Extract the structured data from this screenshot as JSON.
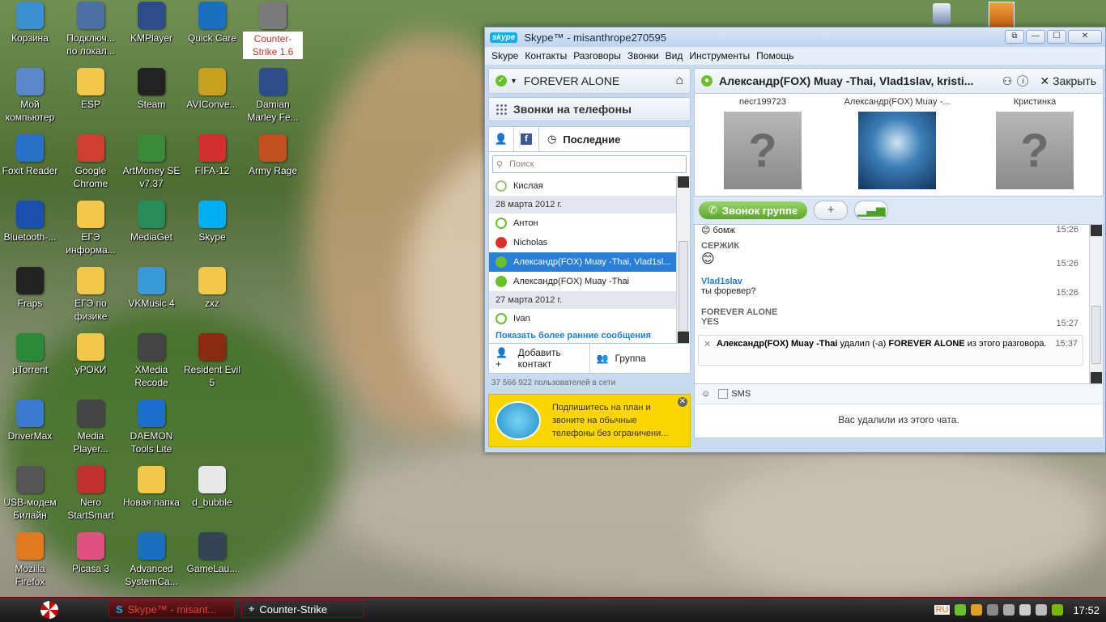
{
  "desktop": {
    "icons": [
      {
        "label": "Корзина",
        "icon": "recycle-bin-icon",
        "color": "#3a8fd0"
      },
      {
        "label": "Подключ... по локал...",
        "icon": "network-connection-icon",
        "color": "#4a6fa0"
      },
      {
        "label": "KMPlayer",
        "icon": "kmplayer-icon",
        "color": "#2c4d8a"
      },
      {
        "label": "Quick Care",
        "icon": "quick-care-icon",
        "color": "#1a6fc0"
      },
      {
        "label": "Counter-Strike 1.6",
        "icon": "counter-strike-icon",
        "color": "#7a7a7a"
      },
      {
        "label": "Мой компьютер",
        "icon": "my-computer-icon",
        "color": "#5a88c8"
      },
      {
        "label": "ESP",
        "icon": "folder-icon",
        "color": "#f2c84b"
      },
      {
        "label": "Steam",
        "icon": "steam-icon",
        "color": "#222222"
      },
      {
        "label": "AVIConve...",
        "icon": "avi-converter-icon",
        "color": "#c8a020"
      },
      {
        "label": "Damian Marley Fe...",
        "icon": "media-file-icon",
        "color": "#2c4d8a"
      },
      {
        "label": "Foxit Reader",
        "icon": "foxit-reader-icon",
        "color": "#2a6fc8"
      },
      {
        "label": "Google Chrome",
        "icon": "chrome-icon",
        "color": "#d04030"
      },
      {
        "label": "ArtMoney SE v7.37",
        "icon": "artmoney-icon",
        "color": "#3a8a3a"
      },
      {
        "label": "FIFA-12",
        "icon": "fifa-icon",
        "color": "#d03030"
      },
      {
        "label": "Army Rage",
        "icon": "army-rage-icon",
        "color": "#c05020"
      },
      {
        "label": "Bluetooth-...",
        "icon": "bluetooth-icon",
        "color": "#1a4fb0"
      },
      {
        "label": "ЕГЭ информа...",
        "icon": "folder-icon",
        "color": "#f2c84b"
      },
      {
        "label": "MediaGet",
        "icon": "mediaget-icon",
        "color": "#2a8a5a"
      },
      {
        "label": "Skype",
        "icon": "skype-icon",
        "color": "#00aff0"
      },
      {
        "label": "Fraps",
        "icon": "fraps-icon",
        "color": "#222222"
      },
      {
        "label": "ЕГЭ по физике",
        "icon": "folder-icon",
        "color": "#f2c84b"
      },
      {
        "label": "VKMusic 4",
        "icon": "vkmusic-icon",
        "color": "#3a9ad8"
      },
      {
        "label": "zxz",
        "icon": "folder-icon",
        "color": "#f2c84b"
      },
      {
        "label": "µTorrent",
        "icon": "utorrent-icon",
        "color": "#2a8a3a"
      },
      {
        "label": "уРОКИ",
        "icon": "folder-icon",
        "color": "#f2c84b"
      },
      {
        "label": "XMedia Recode",
        "icon": "xmedia-recode-icon",
        "color": "#444444"
      },
      {
        "label": "Resident Evil 5",
        "icon": "resident-evil-icon",
        "color": "#8a2a10"
      },
      {
        "label": "DriverMax",
        "icon": "drivermax-icon",
        "color": "#3a7ad0"
      },
      {
        "label": "Media Player...",
        "icon": "media-player-icon",
        "color": "#444444"
      },
      {
        "label": "DAEMON Tools Lite",
        "icon": "daemon-tools-icon",
        "color": "#1a6fd0"
      },
      {
        "label": "USB-модем Билайн",
        "icon": "usb-modem-icon",
        "color": "#555555"
      },
      {
        "label": "Nero StartSmart",
        "icon": "nero-icon",
        "color": "#c03030"
      },
      {
        "label": "Новая папка",
        "icon": "folder-icon",
        "color": "#f2c84b"
      },
      {
        "label": "d_bubble",
        "icon": "file-icon",
        "color": "#e8e8e8"
      },
      {
        "label": "Mozilla Firefox",
        "icon": "firefox-icon",
        "color": "#e07a20"
      },
      {
        "label": "Picasa 3",
        "icon": "picasa-icon",
        "color": "#e05080"
      },
      {
        "label": "Advanced SystemCa...",
        "icon": "advanced-systemcare-icon",
        "color": "#1a6fc0"
      },
      {
        "label": "GameLau...",
        "icon": "game-launcher-icon",
        "color": "#334455"
      }
    ]
  },
  "skype": {
    "title": "Skype™ - misanthrope270595",
    "logo": "skype",
    "window_buttons": {
      "restore": "⧉",
      "minimize": "—",
      "maximize": "☐",
      "close": "✕"
    },
    "menu": [
      "Skype",
      "Контакты",
      "Разговоры",
      "Звонки",
      "Вид",
      "Инструменты",
      "Помощь"
    ],
    "user_status": "FOREVER ALONE",
    "phones_label": "Звонки на телефоны",
    "tab_recent": "Последние",
    "tab_fb": "f",
    "search_placeholder": "Поиск",
    "contacts": [
      {
        "kind": "contact",
        "name": "Кислая",
        "status": "off"
      },
      {
        "kind": "date",
        "name": "28 марта 2012 г."
      },
      {
        "kind": "contact",
        "name": "Антон",
        "status": "online"
      },
      {
        "kind": "contact",
        "name": "Nicholas",
        "status": "busy"
      },
      {
        "kind": "contact",
        "name": "Александр(FOX) Muay -Thai, Vlad1sl...",
        "status": "group",
        "selected": true
      },
      {
        "kind": "contact",
        "name": "Александр(FOX) Muay -Thai",
        "status": "filled"
      },
      {
        "kind": "date",
        "name": "27 марта 2012 г."
      },
      {
        "kind": "contact",
        "name": "Ivan",
        "status": "online"
      }
    ],
    "show_more": "Показать более ранние сообщения",
    "add_contact": "Добавить контакт",
    "group": "Группа",
    "online_count": "37 566 922 пользователей в сети",
    "promo_text": "Подпишитесь на план и звоните на обычные телефоны без ограничени...",
    "conversation": {
      "title": "Александр(FOX) Muay -Thai, Vlad1slav, kristi...",
      "close_label": "Закрыть",
      "participants": [
        {
          "name": "necr199723",
          "avatar": "?"
        },
        {
          "name": "Александр(FOX) Muay -...",
          "avatar": "photo"
        },
        {
          "name": "Кристинка",
          "avatar": "?"
        }
      ],
      "call_group": "Звонок группе",
      "plus": "+",
      "messages": [
        {
          "sender": "",
          "text": "бомж",
          "time": "15:26"
        },
        {
          "sender": "СЕРЖИК",
          "text": "😊",
          "time": "15:26"
        },
        {
          "sender": "Vlad1slav",
          "text": "ты форевер?",
          "time": "15:26"
        },
        {
          "sender": "FOREVER ALONE",
          "text": "YES",
          "time": "15:27"
        }
      ],
      "notice": {
        "actor": "Александр(FOX) Muay -Thai",
        "action1": " удалил (-а) ",
        "target": "FOREVER ALONE",
        "action2": " из этого разговора.",
        "time": "15:37"
      },
      "sms_label": "SMS",
      "removed_text": "Вас удалили из этого чата."
    }
  },
  "taskbar": {
    "tasks": [
      {
        "label": "Skype™ - misant...",
        "icon": "skype-icon",
        "active": true
      },
      {
        "label": "Counter-Strike",
        "icon": "counter-strike-icon",
        "active": false
      }
    ],
    "lang": "RU",
    "clock": "17:52"
  }
}
